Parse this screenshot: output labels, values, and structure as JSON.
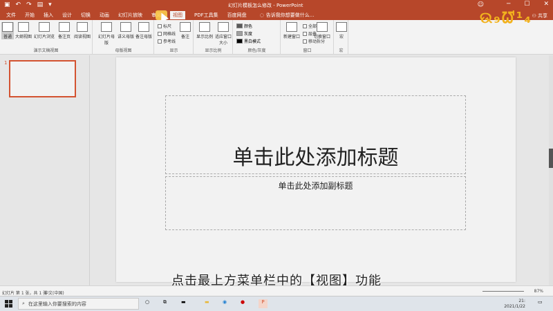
{
  "window": {
    "title": "幻灯片模板怎么修改 - PowerPoint",
    "signin": "☺",
    "controls": [
      "─",
      "☐",
      "✕"
    ]
  },
  "tabs": [
    {
      "label": "文件"
    },
    {
      "label": "开始"
    },
    {
      "label": "插入"
    },
    {
      "label": "设计"
    },
    {
      "label": "切换"
    },
    {
      "label": "动画"
    },
    {
      "label": "幻灯片放映"
    },
    {
      "label": "审阅"
    },
    {
      "label": "视图"
    },
    {
      "label": "PDF工具集"
    },
    {
      "label": "百度网盘"
    }
  ],
  "tellme": "告诉我你想要做什么...",
  "share": "共享",
  "ribbon": {
    "presentation_views": {
      "label": "演示文稿视图",
      "buttons": [
        "普通",
        "大纲视图",
        "幻灯片浏览",
        "备注页",
        "阅读视图"
      ]
    },
    "master_views": {
      "label": "母版视图",
      "buttons": [
        "幻灯片母版",
        "讲义母版",
        "备注母版"
      ]
    },
    "show": {
      "label": "显示",
      "checks": [
        "标尺",
        "网格线",
        "参考线"
      ],
      "notes": "备注"
    },
    "zoom": {
      "label": "显示比例",
      "buttons": [
        "显示比例",
        "适应窗口大小"
      ]
    },
    "color": {
      "label": "颜色/灰度",
      "items": [
        "颜色",
        "灰度",
        "黑白模式"
      ],
      "swatches": [
        "#5a5a5a",
        "#a0a0a0",
        "#000000"
      ]
    },
    "window": {
      "label": "窗口",
      "new_window": "新建窗口",
      "items": [
        "全部重排",
        "层叠",
        "移动拆分"
      ],
      "switch": "切换窗口"
    },
    "macro": {
      "label": "宏",
      "button": "宏"
    }
  },
  "thumbnail": {
    "number": "1"
  },
  "slide": {
    "title_placeholder": "单击此处添加标题",
    "subtitle_placeholder": "单击此处添加副标题"
  },
  "caption": "点击最上方菜单栏中的【视图】功能",
  "statusbar": {
    "slide_info": "幻灯片 第 1 张，共 1 张",
    "language": "中文(中国)",
    "zoom": "87%"
  },
  "taskbar": {
    "search_placeholder": "在这里输入你要搜索的内容",
    "time": "21:",
    "date": "2021/1/22"
  },
  "logo": "ଉ₉ᘺ¹₄"
}
